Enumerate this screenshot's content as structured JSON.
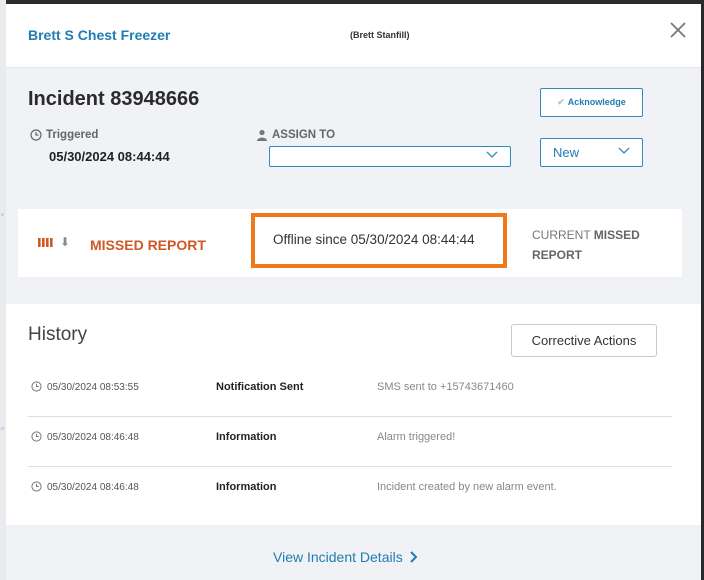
{
  "header": {
    "device_name": "Brett S Chest Freezer",
    "owner": "(Brett Stanfill)",
    "close_icon": "close-icon"
  },
  "incident": {
    "title": "Incident 83948666",
    "triggered_label": "Triggered",
    "triggered_value": "05/30/2024 08:44:44",
    "assign_label": "ASSIGN TO",
    "assign_value": "",
    "acknowledge_label": "Acknowledge",
    "status_value": "New"
  },
  "alarm": {
    "type_label": "MISSED REPORT",
    "offline_text": "Offline since 05/30/2024 08:44:44",
    "current_prefix": "CURRENT",
    "current_bold": "MISSED",
    "current_suffix": "REPORT",
    "accent_color": "#cf5824",
    "highlight_color": "#f07a1a"
  },
  "history": {
    "title": "History",
    "corrective_actions_label": "Corrective Actions",
    "rows": [
      {
        "timestamp": "05/30/2024 08:53:55",
        "type": "Notification Sent",
        "message": "SMS sent to +15743671460"
      },
      {
        "timestamp": "05/30/2024 08:46:48",
        "type": "Information",
        "message": "Alarm triggered!"
      },
      {
        "timestamp": "05/30/2024 08:46:48",
        "type": "Information",
        "message": "Incident created by new alarm event."
      }
    ]
  },
  "footer": {
    "view_details_label": "View Incident Details"
  }
}
